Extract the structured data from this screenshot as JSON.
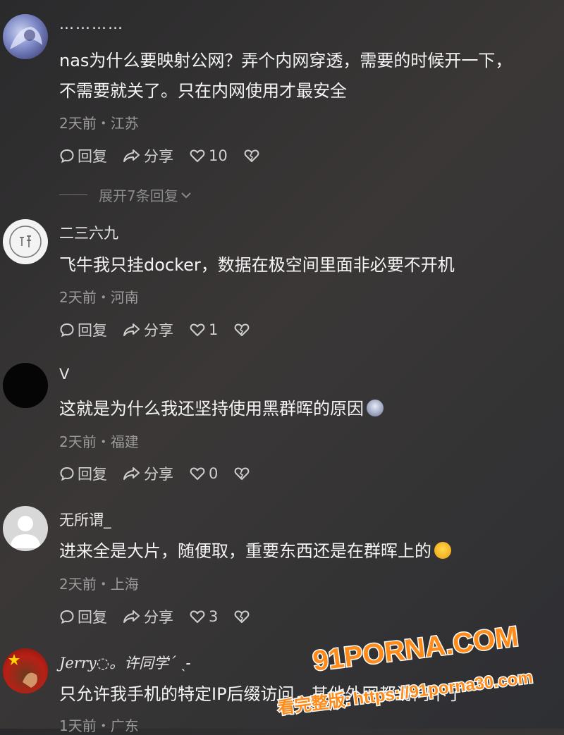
{
  "comments": [
    {
      "username": "…………",
      "text_lines": [
        "nas为什么要映射公网？弄个内网穿透，需要的时候开一下，",
        "不需要就关了。只在内网使用才最安全"
      ],
      "meta": "2天前・江苏",
      "reply": "回复",
      "share": "分享",
      "likes": "10",
      "expand": "展开7条回复"
    },
    {
      "username": "二三六九",
      "text_lines": [
        "飞牛我只挂docker，数据在极空间里面非必要不开机"
      ],
      "meta": "2天前・河南",
      "reply": "回复",
      "share": "分享",
      "likes": "1"
    },
    {
      "username": "V",
      "text_lines": [
        "这就是为什么我还坚持使用黑群晖的原因"
      ],
      "meta": "2天前・福建",
      "reply": "回复",
      "share": "分享",
      "likes": "0"
    },
    {
      "username": "无所谓_",
      "text_lines": [
        "进来全是大片，随便取，重要东西还是在群晖上的"
      ],
      "meta": "2天前・上海",
      "reply": "回复",
      "share": "分享",
      "likes": "3"
    },
    {
      "username": "Jerry◌。许同学´ ˎ˗",
      "text_lines": [
        "只允许我手机的特定IP后缀访问，其他外网都访问不了"
      ],
      "meta": "1天前・广东"
    }
  ],
  "watermark": {
    "brand": "91PORNA.COM",
    "prefix": "看完整版:",
    "url": "https://91porna30.com"
  },
  "colors": {
    "watermark_orange": "#ff8c1a",
    "heart_outline": "#cfcfcf"
  }
}
